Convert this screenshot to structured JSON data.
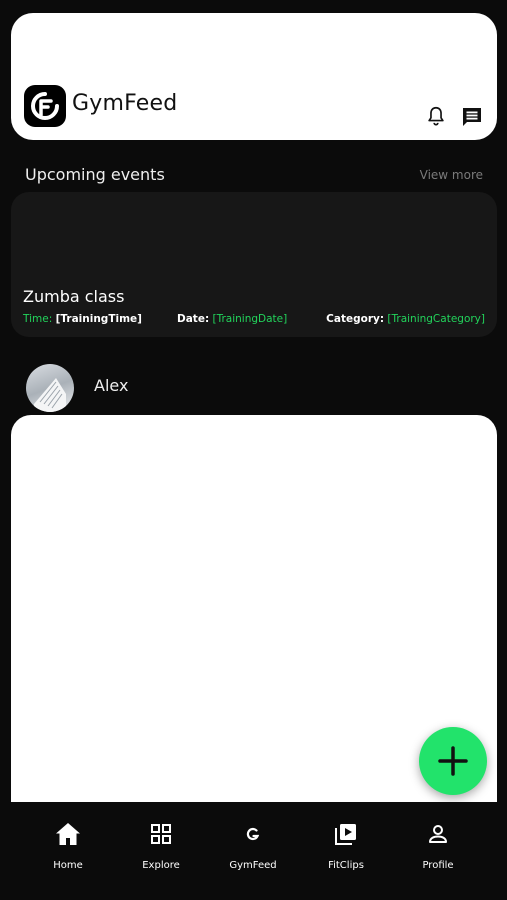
{
  "header": {
    "app_title": "GymFeed",
    "logo_icon": "gymfeed-logo-icon",
    "icons": [
      "bell-icon",
      "chat-icon"
    ]
  },
  "events": {
    "section_title": "Upcoming events",
    "view_more": "View more",
    "card": {
      "title": "Zumba class",
      "time_label": "Time:",
      "time_value": "[TrainingTime]",
      "date_label": "Date:",
      "date_value": "[TrainingDate]",
      "category_label": "Category:",
      "category_value": "[TrainingCategory]"
    }
  },
  "post": {
    "user_name": "Alex"
  },
  "fab": {
    "icon": "plus-icon"
  },
  "nav": {
    "items": [
      {
        "label": "Home",
        "icon": "home-icon"
      },
      {
        "label": "Explore",
        "icon": "grid-icon"
      },
      {
        "label": "GymFeed",
        "icon": "g-letter-icon"
      },
      {
        "label": "FitClips",
        "icon": "video-library-icon"
      },
      {
        "label": "Profile",
        "icon": "person-icon"
      }
    ]
  },
  "colors": {
    "background": "#0b0b0b",
    "card": "#171717",
    "accent_green": "#22e36b",
    "label_green": "#22d35b"
  }
}
